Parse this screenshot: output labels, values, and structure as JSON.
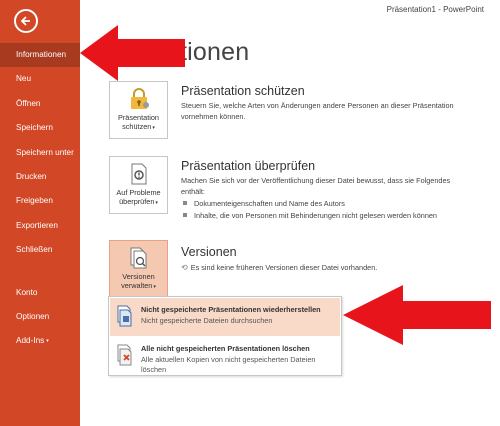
{
  "window": {
    "title": "Präsentation1 - PowerPoint"
  },
  "sidebar": {
    "items": [
      {
        "label": "Informationen"
      },
      {
        "label": "Neu"
      },
      {
        "label": "Öffnen"
      },
      {
        "label": "Speichern"
      },
      {
        "label": "Speichern unter"
      },
      {
        "label": "Drucken"
      },
      {
        "label": "Freigeben"
      },
      {
        "label": "Exportieren"
      },
      {
        "label": "Schließen"
      },
      {
        "label": "Konto"
      },
      {
        "label": "Optionen"
      },
      {
        "label": "Add-Ins"
      }
    ]
  },
  "main": {
    "title": "tionen",
    "protect": {
      "button_line1": "Präsentation",
      "button_line2": "schützen",
      "title": "Präsentation schützen",
      "desc": "Steuern Sie, welche Arten von Änderungen andere Personen an dieser Präsentation vornehmen können."
    },
    "inspect": {
      "button_line1": "Auf Probleme",
      "button_line2": "überprüfen",
      "title": "Präsentation überprüfen",
      "desc": "Machen Sie sich vor der Veröffentlichung dieser Datei bewusst, dass sie Folgendes enthält:",
      "bullets": [
        "Dokumenteigenschaften und Name des Autors",
        "Inhalte, die von Personen mit Behinderungen nicht gelesen werden können"
      ]
    },
    "versions": {
      "button_line1": "Versionen",
      "button_line2": "verwalten",
      "title": "Versionen",
      "desc": "Es sind keine früheren Versionen dieser Datei vorhanden."
    }
  },
  "dropdown": {
    "items": [
      {
        "title": "Nicht gespeicherte Präsentationen wiederherstellen",
        "desc": "Nicht gespeicherte Dateien durchsuchen"
      },
      {
        "title": "Alle nicht gespeicherten Präsentationen löschen",
        "desc": "Alle aktuellen Kopien von nicht gespeicherten Dateien löschen"
      }
    ]
  },
  "colors": {
    "accent": "#d24726",
    "active": "#a83a1f",
    "highlight": "#f9d9c8",
    "arrow": "#e8141c"
  }
}
